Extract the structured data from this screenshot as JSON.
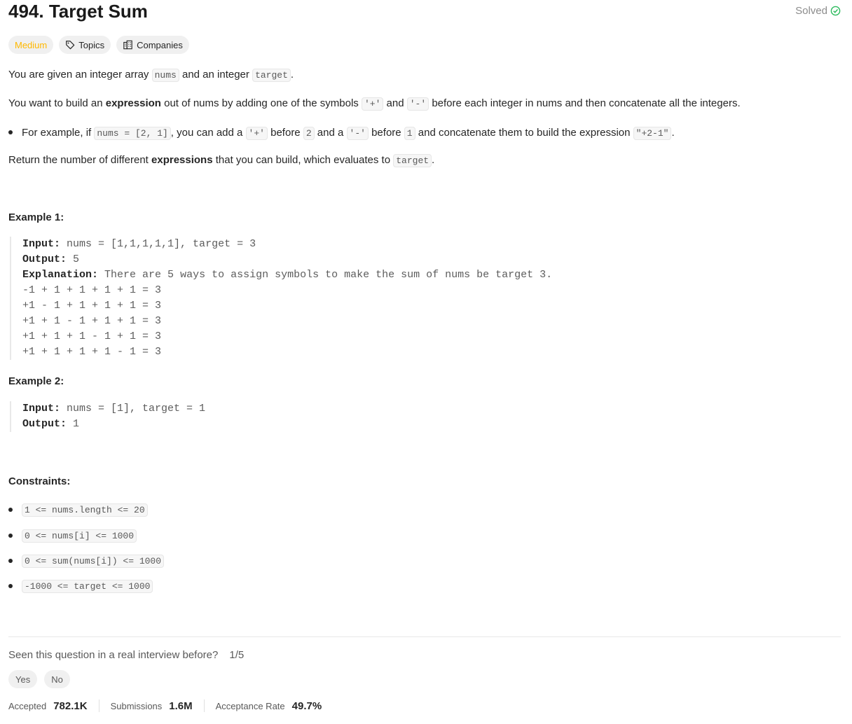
{
  "problem": {
    "title": "494. Target Sum",
    "status_label": "Solved",
    "difficulty": "Medium",
    "topics_label": "Topics",
    "companies_label": "Companies"
  },
  "description": {
    "p1_a": "You are given an integer array ",
    "p1_code1": "nums",
    "p1_b": " and an integer ",
    "p1_code2": "target",
    "p1_c": ".",
    "p2_a": "You want to build an ",
    "p2_bold": "expression",
    "p2_b": " out of nums by adding one of the symbols ",
    "p2_code1": "'+'",
    "p2_c": " and ",
    "p2_code2": "'-'",
    "p2_d": " before each integer in nums and then concatenate all the integers.",
    "b_a": "For example, if ",
    "b_code1": "nums = [2, 1]",
    "b_b": ", you can add a ",
    "b_code2": "'+'",
    "b_c": " before ",
    "b_code3": "2",
    "b_d": " and a ",
    "b_code4": "'-'",
    "b_e": " before ",
    "b_code5": "1",
    "b_f": " and concatenate them to build the expression ",
    "b_code6": "\"+2-1\"",
    "b_g": ".",
    "p3_a": "Return the number of different ",
    "p3_bold": "expressions",
    "p3_b": " that you can build, which evaluates to ",
    "p3_code": "target",
    "p3_c": "."
  },
  "examples": [
    {
      "heading": "Example 1:",
      "input_label": "Input:",
      "input": "nums = [1,1,1,1,1], target = 3",
      "output_label": "Output:",
      "output": "5",
      "explanation_label": "Explanation:",
      "explanation": "There are 5 ways to assign symbols to make the sum of nums be target 3.",
      "lines": [
        "-1 + 1 + 1 + 1 + 1 = 3",
        "+1 - 1 + 1 + 1 + 1 = 3",
        "+1 + 1 - 1 + 1 + 1 = 3",
        "+1 + 1 + 1 - 1 + 1 = 3",
        "+1 + 1 + 1 + 1 - 1 = 3"
      ]
    },
    {
      "heading": "Example 2:",
      "input_label": "Input:",
      "input": "nums = [1], target = 1",
      "output_label": "Output:",
      "output": "1"
    }
  ],
  "constraints": {
    "heading": "Constraints:",
    "items": [
      "1 <= nums.length <= 20",
      "0 <= nums[i] <= 1000",
      "0 <= sum(nums[i]) <= 1000",
      "-1000 <= target <= 1000"
    ]
  },
  "interview": {
    "question": "Seen this question in a real interview before?",
    "count": "1/5",
    "yes_label": "Yes",
    "no_label": "No"
  },
  "stats": {
    "accepted_label": "Accepted",
    "accepted_value": "782.1K",
    "submissions_label": "Submissions",
    "submissions_value": "1.6M",
    "rate_label": "Acceptance Rate",
    "rate_value": "49.7%"
  },
  "colors": {
    "medium": "#ffb800",
    "solved_check": "#2cbb5d"
  },
  "icons": [
    "check-circle-icon",
    "tag-icon",
    "building-icon"
  ]
}
